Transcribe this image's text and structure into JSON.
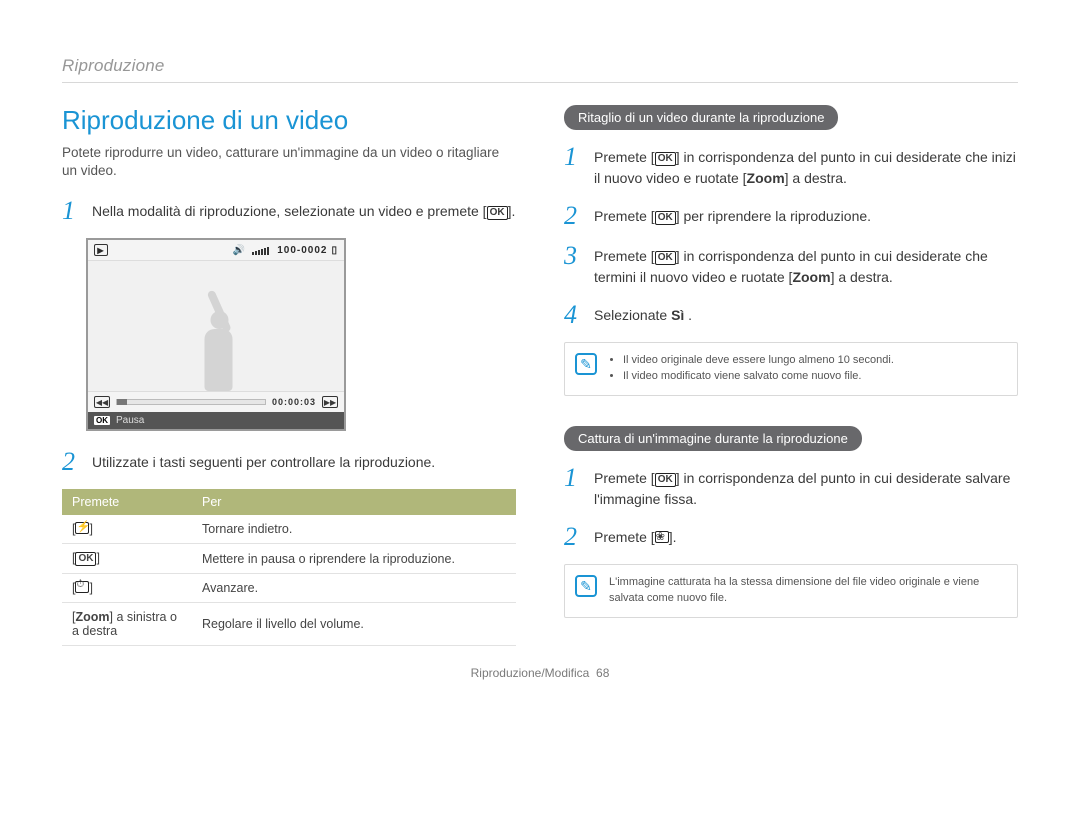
{
  "breadcrumb": "Riproduzione",
  "title": "Riproduzione di un video",
  "intro": "Potete riprodurre un video, catturare un'immagine da un video o ritagliare un video.",
  "left": {
    "step1_pre": "Nella modalità di riproduzione, selezionate un video e premete [",
    "step1_post": "].",
    "lcd": {
      "counter": "100-0002",
      "time": "00:00:03",
      "pause": "Pausa",
      "ok": "OK",
      "vol_icon": "volume-icon"
    },
    "step2": "Utilizzate i tasti seguenti per controllare la riproduzione.",
    "table": {
      "head": [
        "Premete",
        "Per"
      ],
      "rows": [
        {
          "key_type": "flash",
          "text": "Tornare indietro."
        },
        {
          "key_type": "ok",
          "text": "Mettere in pausa o riprendere la riproduzione."
        },
        {
          "key_type": "timer",
          "text": "Avanzare."
        },
        {
          "key_type": "zoom",
          "label_pre": "[",
          "label_mid": "Zoom",
          "label_post": "] a sinistra o a destra",
          "text": "Regolare il livello del volume."
        }
      ]
    }
  },
  "right": {
    "section1_title": "Ritaglio di un video durante la riproduzione",
    "s1_step1_a": "Premete [",
    "s1_step1_b": "] in corrispondenza del punto in cui desiderate che inizi il nuovo video e ruotate [",
    "s1_step1_c": "Zoom",
    "s1_step1_d": "] a destra.",
    "s1_step2_a": "Premete [",
    "s1_step2_b": "] per riprendere la riproduzione.",
    "s1_step3_a": "Premete [",
    "s1_step3_b": "] in corrispondenza del punto in cui desiderate che termini il nuovo video e ruotate [",
    "s1_step3_c": "Zoom",
    "s1_step3_d": "] a destra.",
    "s1_step4_a": "Selezionate ",
    "s1_step4_b": "Sì",
    "s1_step4_c": " .",
    "note1": [
      "Il video originale deve essere lungo almeno 10 secondi.",
      "Il video modificato viene salvato come nuovo file."
    ],
    "section2_title": "Cattura di un'immagine durante la riproduzione",
    "s2_step1_a": "Premete [",
    "s2_step1_b": "] in corrispondenza del punto in cui desiderate salvare l'immagine fissa.",
    "s2_step2_a": "Premete [",
    "s2_step2_b": "].",
    "note2": "L'immagine catturata ha la stessa dimensione del file video originale e viene salvata come nuovo file."
  },
  "footer_a": "Riproduzione/Modifica",
  "footer_b": "68",
  "ok_label": "OK"
}
